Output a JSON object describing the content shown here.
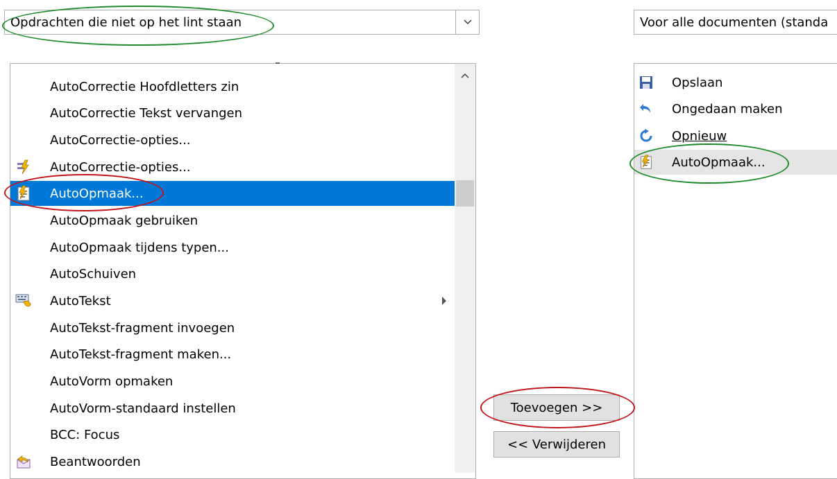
{
  "left_combo": {
    "value": "Opdrachten die niet op het lint staan",
    "icon": "chevron-down-icon"
  },
  "right_combo": {
    "value": "Voor alle documenten (standa"
  },
  "left_list": {
    "items": [
      {
        "label": "AutoCorrectie Hoofdletters zin",
        "icon": ""
      },
      {
        "label": "AutoCorrectie Tekst vervangen",
        "icon": ""
      },
      {
        "label": "AutoCorrectie-opties...",
        "icon": ""
      },
      {
        "label": "AutoCorrectie-opties...",
        "icon": "autocorrect-lightning-icon"
      },
      {
        "label": "AutoOpmaak...",
        "icon": "autoformat-icon",
        "selected": true
      },
      {
        "label": "AutoOpmaak gebruiken",
        "icon": ""
      },
      {
        "label": "AutoOpmaak tijdens typen...",
        "icon": ""
      },
      {
        "label": "AutoSchuiven",
        "icon": ""
      },
      {
        "label": "AutoTekst",
        "icon": "autotext-keyboard-icon",
        "submenu": true
      },
      {
        "label": "AutoTekst-fragment invoegen",
        "icon": ""
      },
      {
        "label": "AutoTekst-fragment maken...",
        "icon": ""
      },
      {
        "label": "AutoVorm opmaken",
        "icon": ""
      },
      {
        "label": "AutoVorm-standaard instellen",
        "icon": ""
      },
      {
        "label": "BCC: Focus",
        "icon": ""
      },
      {
        "label": "Beantwoorden",
        "icon": "reply-envelope-icon"
      }
    ]
  },
  "right_list": {
    "items": [
      {
        "label": "Opslaan",
        "icon": "save-icon"
      },
      {
        "label": "Ongedaan maken",
        "icon": "undo-icon"
      },
      {
        "label": "Opnieuw",
        "icon": "redo-icon"
      },
      {
        "label": "AutoOpmaak...",
        "icon": "autoformat-icon",
        "highlighted": true
      }
    ]
  },
  "buttons": {
    "add_label": "Toevoegen >>",
    "remove_label": "<< Verwijderen"
  },
  "colors": {
    "selection": "#0078d7",
    "annotation_green": "#1e8a2a",
    "annotation_red": "#c0141c"
  }
}
